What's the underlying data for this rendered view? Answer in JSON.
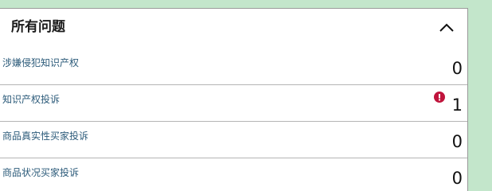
{
  "panel": {
    "title": "所有问题",
    "collapse_icon": "chevron-up-icon"
  },
  "rows": [
    {
      "label": "涉嫌侵犯知识产权",
      "count": "0",
      "has_alert": false
    },
    {
      "label": "知识产权投诉",
      "count": "1",
      "has_alert": true
    },
    {
      "label": "商品真实性买家投诉",
      "count": "0",
      "has_alert": false
    },
    {
      "label": "商品状况买家投诉",
      "count": "0",
      "has_alert": false
    }
  ],
  "colors": {
    "background_accent": "#c3e6cb",
    "link_text": "#2c5b7a",
    "alert": "#c0143c"
  },
  "icons": {
    "alert": "exclamation-alert-icon"
  }
}
